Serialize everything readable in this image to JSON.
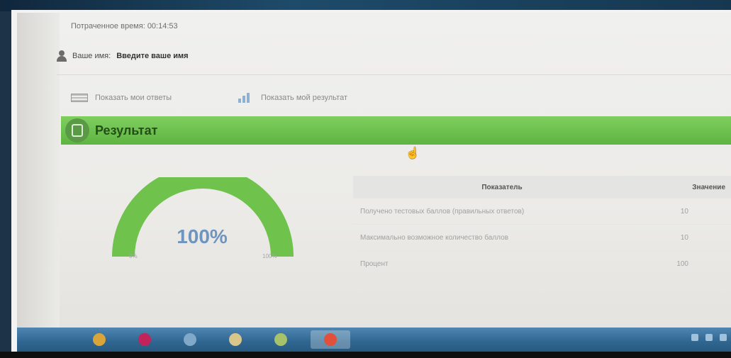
{
  "header": {
    "time_text": "Потраченное время: 00:14:53",
    "user_prefix": "Ваше имя:",
    "user_name": "Введите ваше имя"
  },
  "links": {
    "show_answers": "Показать мои ответы",
    "show_result": "Показать мой результат"
  },
  "result_panel": {
    "title": "Результат"
  },
  "gauge": {
    "value_text": "100%",
    "min_label": "0%",
    "max_label": "100%",
    "fraction": 1.0,
    "color": "#6fc24b"
  },
  "table": {
    "headers": [
      "Показатель",
      "Значение"
    ],
    "rows": [
      {
        "indicator": "Получено тестовых баллов (правильных ответов)",
        "value": "10"
      },
      {
        "indicator": "Максимально возможное количество баллов",
        "value": "10"
      },
      {
        "indicator": "Процент",
        "value": "100"
      }
    ]
  },
  "taskbar": {
    "items": [
      {
        "name": "chrome-icon",
        "color": "#d9a53a"
      },
      {
        "name": "opera-icon",
        "color": "#c0245b"
      },
      {
        "name": "people-icon",
        "color": "#7fa8c9"
      },
      {
        "name": "folder-icon",
        "color": "#d9c68a"
      },
      {
        "name": "app-icon",
        "color": "#a7c26a"
      },
      {
        "name": "yandex-icon",
        "color": "#e0503b"
      }
    ]
  }
}
